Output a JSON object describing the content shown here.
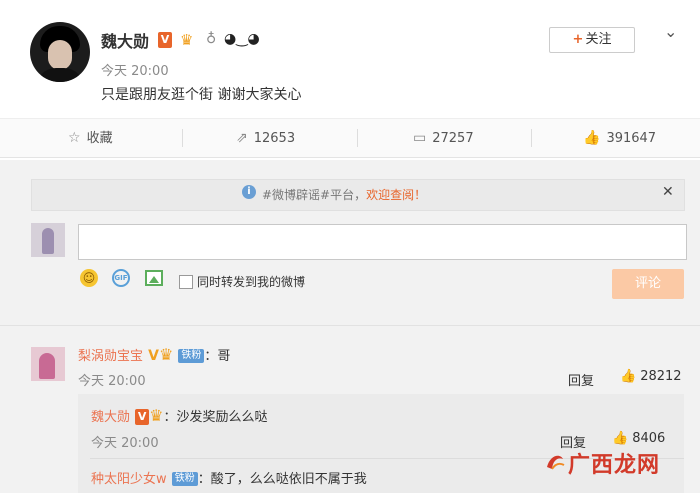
{
  "post": {
    "username": "魏大勋",
    "vip_badge": "V",
    "time": "今天 20:00",
    "text": "只是跟朋友逛个街 谢谢大家关心",
    "follow_label": "关注"
  },
  "actions": {
    "favorite": "收藏",
    "reposts": "12653",
    "comments": "27257",
    "likes": "391647"
  },
  "notice": {
    "text_prefix": "#微博辟谣#平台，",
    "text_highlight": "欢迎查阅！"
  },
  "composer": {
    "input_value": "",
    "checkbox_label": "同时转发到我的微博",
    "submit_label": "评论"
  },
  "comments": [
    {
      "name": "梨涡勋宝宝",
      "vip": "V",
      "fan_badge": "铁粉",
      "text": "：哥",
      "time": "今天 20:00",
      "reply_label": "回复",
      "likes": "28212",
      "replies": [
        {
          "name": "魏大勋",
          "vip": "V",
          "text": "：沙发奖励么么哒",
          "time": "今天 20:00",
          "reply_label": "回复",
          "likes": "8406"
        },
        {
          "name": "种太阳少女w",
          "fan_badge": "铁粉",
          "text": "：酸了，么么哒依旧不属于我"
        }
      ]
    }
  ],
  "watermark": "广西龙网",
  "colors": {
    "accent": "#e8652b",
    "username_link": "#eb7350",
    "submit_disabled": "#fbc9a5"
  }
}
